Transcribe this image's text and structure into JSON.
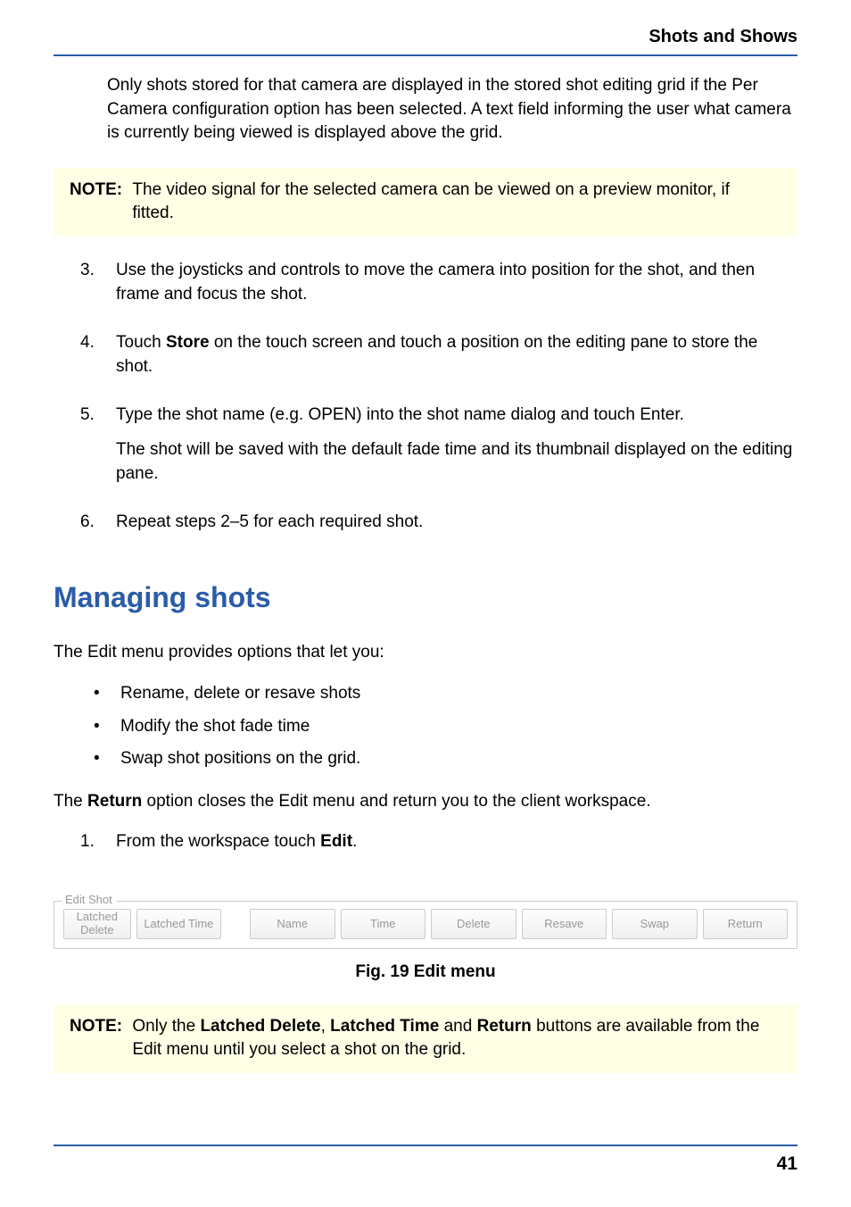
{
  "header": {
    "title": "Shots and Shows"
  },
  "intro": "Only shots stored for that camera are displayed in the stored shot editing grid if the Per Camera configuration option has been selected. A text field informing the user what camera is currently being viewed is displayed above the grid.",
  "note1": {
    "label": "NOTE:",
    "text": "The video signal for the selected camera can be viewed on a preview monitor, if fitted."
  },
  "steps": [
    {
      "num": "3.",
      "paras": [
        "Use the joysticks and controls to move the camera into position for the shot, and then frame and focus the shot."
      ]
    },
    {
      "num": "4.",
      "paras_html": "Touch <b>Store</b> on the touch screen and touch a position on the editing pane to store the shot."
    },
    {
      "num": "5.",
      "paras": [
        "Type the shot name (e.g. OPEN) into the shot name dialog and touch Enter.",
        "The shot will be saved with the default fade time and its thumbnail displayed on the editing pane."
      ]
    },
    {
      "num": "6.",
      "paras": [
        "Repeat steps 2–5 for each required shot."
      ]
    }
  ],
  "section_heading": "Managing shots",
  "edit_intro": "The Edit menu provides options that let you:",
  "bullets": [
    "Rename, delete or resave shots",
    "Modify the shot fade time",
    "Swap shot positions on the grid."
  ],
  "return_text_prefix": "The ",
  "return_text_bold": "Return",
  "return_text_suffix": " option closes the Edit menu and return you to the client workspace.",
  "step_from": {
    "num": "1.",
    "text_prefix": "From the workspace touch ",
    "text_bold": "Edit",
    "text_suffix": "."
  },
  "edit_menu": {
    "legend": "Edit Shot",
    "buttons": [
      {
        "label": "Latched\nDelete"
      },
      {
        "label": "Latched Time"
      },
      {
        "label": "Name"
      },
      {
        "label": "Time"
      },
      {
        "label": "Delete"
      },
      {
        "label": "Resave"
      },
      {
        "label": "Swap"
      },
      {
        "label": "Return"
      }
    ]
  },
  "fig_caption": "Fig. 19  Edit menu",
  "note2": {
    "label": "NOTE:",
    "prefix": "Only the ",
    "b1": "Latched Delete",
    "mid1": ", ",
    "b2": "Latched Time",
    "mid2": " and ",
    "b3": "Return",
    "suffix": " buttons are available from the Edit menu until you select a shot on the grid."
  },
  "page_number": "41"
}
